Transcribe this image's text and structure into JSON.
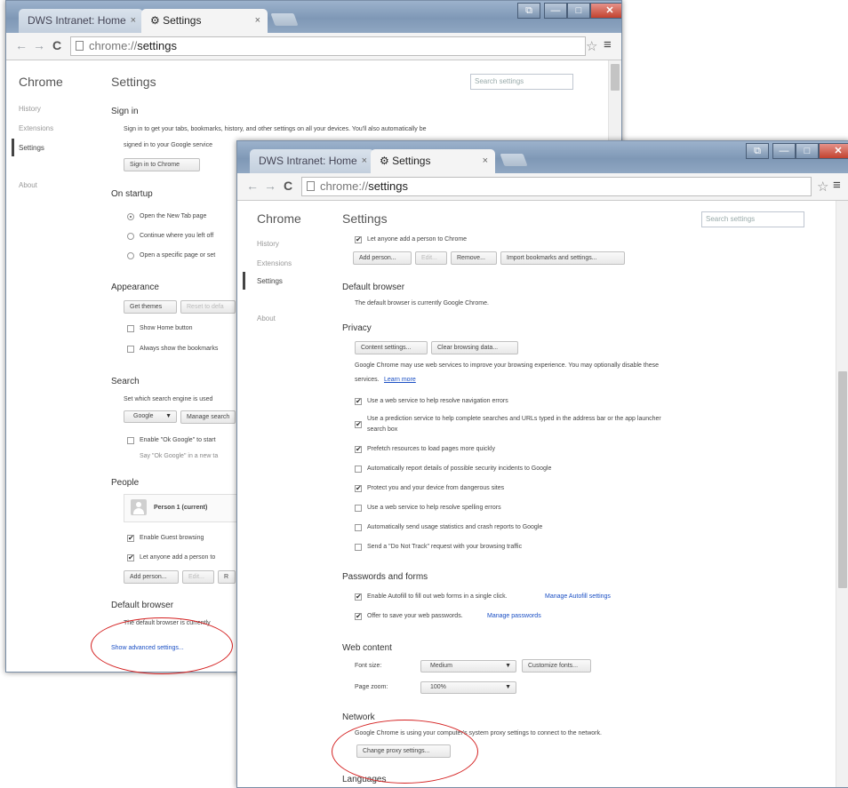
{
  "back_window": {
    "tabs": [
      {
        "label": "DWS Intranet: Home"
      },
      {
        "label": "Settings"
      }
    ],
    "address": {
      "scheme": "chrome://",
      "path": "settings"
    },
    "sidebar": {
      "title": "Chrome",
      "items": [
        "History",
        "Extensions",
        "Settings",
        "About"
      ]
    },
    "settings_title": "Settings",
    "search_placeholder": "Search settings",
    "signin": {
      "header": "Sign in",
      "desc_line1": "Sign in to get your tabs, bookmarks, history, and other settings on all your devices. You'll also automatically be",
      "desc_line2": "signed in to your Google service",
      "button": "Sign in to Chrome"
    },
    "startup": {
      "header": "On startup",
      "options": [
        "Open the New Tab page",
        "Continue where you left off",
        "Open a specific page or set"
      ]
    },
    "appearance": {
      "header": "Appearance",
      "get_themes": "Get themes",
      "reset": "Reset to defa",
      "show_home": "Show Home button",
      "show_bookmarks": "Always show the bookmarks"
    },
    "search": {
      "header": "Search",
      "desc": "Set which search engine is used",
      "engine": "Google",
      "manage": "Manage search",
      "ok_google": "Enable \"Ok Google\" to start",
      "ok_google_sub": "Say \"Ok Google\" in a new ta"
    },
    "people": {
      "header": "People",
      "person": "Person 1 (current)",
      "guest": "Enable Guest browsing",
      "anyone": "Let anyone add a person to",
      "add": "Add person...",
      "edit": "Edit...",
      "remove_stub": "R"
    },
    "default_browser": {
      "header": "Default browser",
      "desc": "The default browser is currently"
    },
    "show_advanced": "Show advanced settings..."
  },
  "front_window": {
    "tabs": [
      {
        "label": "DWS Intranet: Home"
      },
      {
        "label": "Settings"
      }
    ],
    "address": {
      "scheme": "chrome://",
      "path": "settings"
    },
    "sidebar": {
      "title": "Chrome",
      "items": [
        "History",
        "Extensions",
        "Settings",
        "About"
      ]
    },
    "settings_title": "Settings",
    "search_placeholder": "Search settings",
    "people": {
      "anyone": "Let anyone add a person to Chrome",
      "buttons": [
        "Add person...",
        "Edit...",
        "Remove...",
        "Import bookmarks and settings..."
      ]
    },
    "default_browser": {
      "header": "Default browser",
      "desc": "The default browser is currently Google Chrome."
    },
    "privacy": {
      "header": "Privacy",
      "content_settings": "Content settings...",
      "clear_data": "Clear browsing data...",
      "desc_line1": "Google Chrome may use web services to improve your browsing experience. You may optionally disable these",
      "desc_line2": "services.",
      "learn_more": "Learn more",
      "options": [
        {
          "label": "Use a web service to help resolve navigation errors",
          "checked": true
        },
        {
          "label": "Use a prediction service to help complete searches and URLs typed in the address bar or the app launcher",
          "label2": "search box",
          "checked": true
        },
        {
          "label": "Prefetch resources to load pages more quickly",
          "checked": true
        },
        {
          "label": "Automatically report details of possible security incidents to Google",
          "checked": false
        },
        {
          "label": "Protect you and your device from dangerous sites",
          "checked": true
        },
        {
          "label": "Use a web service to help resolve spelling errors",
          "checked": false
        },
        {
          "label": "Automatically send usage statistics and crash reports to Google",
          "checked": false
        },
        {
          "label": "Send a \"Do Not Track\" request with your browsing traffic",
          "checked": false
        }
      ]
    },
    "passwords": {
      "header": "Passwords and forms",
      "autofill": "Enable Autofill to fill out web forms in a single click.",
      "autofill_link": "Manage Autofill settings",
      "offer_save": "Offer to save your web passwords.",
      "passwords_link": "Manage passwords"
    },
    "web_content": {
      "header": "Web content",
      "font_size_label": "Font size:",
      "font_size_value": "Medium",
      "customize_fonts": "Customize fonts...",
      "zoom_label": "Page zoom:",
      "zoom_value": "100%"
    },
    "network": {
      "header": "Network",
      "desc": "Google Chrome is using your computer's system proxy settings to connect to the network.",
      "button": "Change proxy settings..."
    },
    "languages": {
      "header": "Languages"
    }
  },
  "annotation_color": "#d42020"
}
